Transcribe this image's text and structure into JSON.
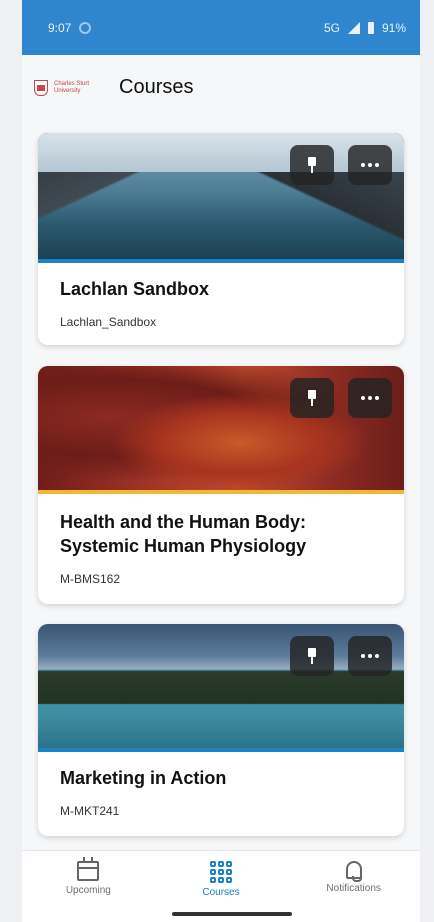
{
  "status_bar": {
    "time": "9:07",
    "network": "5G",
    "battery": "91%"
  },
  "app_bar": {
    "logo_text": "Charles Sturt University",
    "title": "Courses"
  },
  "courses": [
    {
      "title": "Lachlan Sandbox",
      "code": "Lachlan_Sandbox"
    },
    {
      "title": "Health and the Human Body: Systemic Human Physiology",
      "code": "M-BMS162"
    },
    {
      "title": "Marketing in Action",
      "code": "M-MKT241"
    }
  ],
  "bottom_nav": {
    "items": [
      {
        "label": "Upcoming",
        "icon": "calendar-icon"
      },
      {
        "label": "Courses",
        "icon": "grid-icon"
      },
      {
        "label": "Notifications",
        "icon": "bell-icon"
      }
    ],
    "active": "Courses"
  },
  "colors": {
    "status_bar": "#2f86cf",
    "accent": "#1b82c4"
  }
}
